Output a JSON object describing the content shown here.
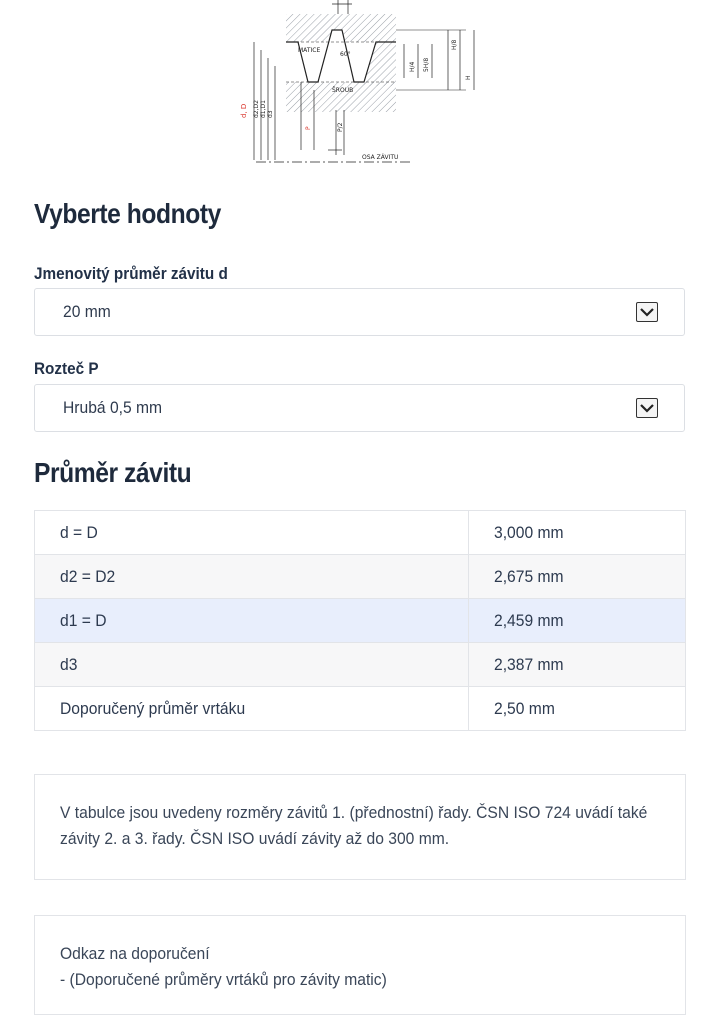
{
  "diagram": {
    "labels": {
      "matice": "MATICE",
      "sroub": "ŠROUB",
      "osa": "OSA ZÁVITU",
      "angle": "60°"
    }
  },
  "section_select": {
    "title": "Vyberte hodnoty",
    "diameter_label": "Jmenovitý průměr závitu d",
    "diameter_value": "20 mm",
    "pitch_label": "Rozteč P",
    "pitch_value": "Hrubá 0,5 mm"
  },
  "section_result": {
    "title": "Průměr závitu",
    "rows": [
      {
        "name": "d = D",
        "value": "3,000 mm"
      },
      {
        "name": "d2 = D2",
        "value": "2,675 mm"
      },
      {
        "name": "d1 = D",
        "value": "2,459 mm"
      },
      {
        "name": "d3",
        "value": "2,387 mm"
      },
      {
        "name": "Doporučený průměr vrtáku",
        "value": "2,50 mm"
      }
    ]
  },
  "note": {
    "line1": "V tabulce jsou uvedeny rozměry závitů 1. (přednostní) řady. ČSN ISO 724 uvádí také",
    "line2": "závity 2. a 3. řady. ČSN ISO uvádí závity až do 300 mm."
  },
  "reference": {
    "title": "Odkaz na doporučení",
    "link": "- (Doporučené průměry vrtáků pro závity matic)"
  },
  "colors": {
    "highlight_row": "#e8eefc",
    "heading": "#1e2a3c",
    "diagram_red": "#d9342b"
  }
}
